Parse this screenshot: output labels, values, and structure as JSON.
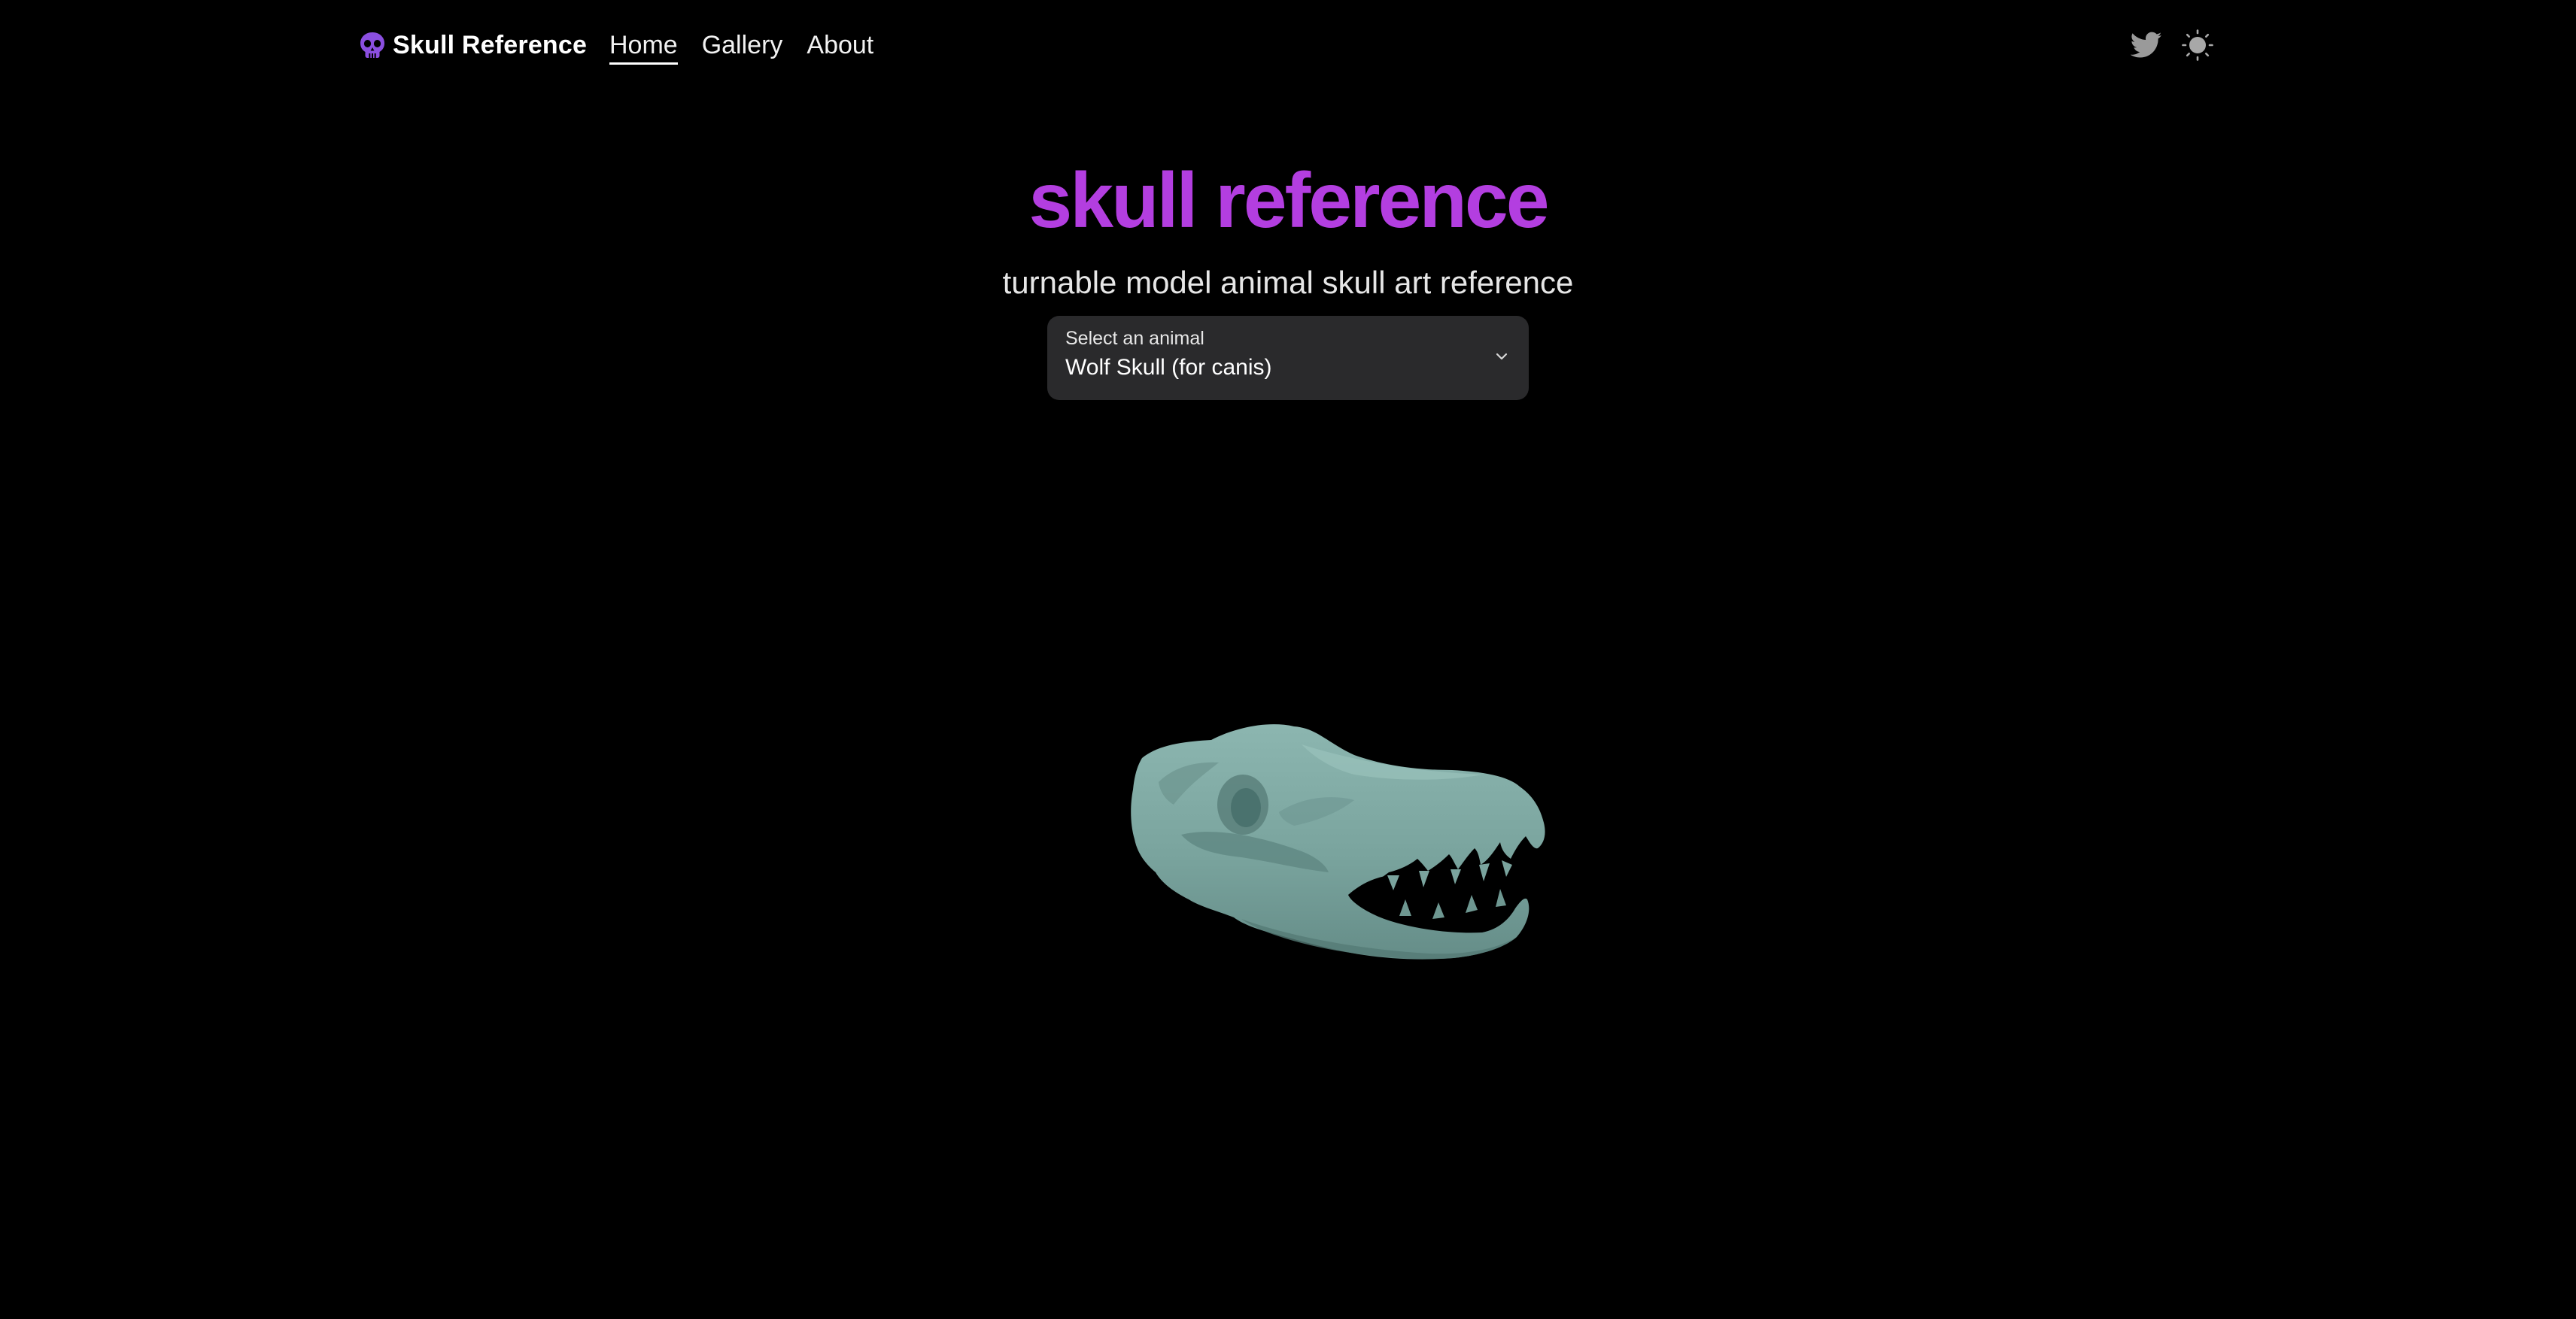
{
  "header": {
    "brand": {
      "name": "Skull Reference",
      "icon": "skull-icon"
    },
    "nav": [
      {
        "label": "Home",
        "active": true
      },
      {
        "label": "Gallery",
        "active": false
      },
      {
        "label": "About",
        "active": false
      }
    ],
    "icons": {
      "twitter": "twitter-icon",
      "theme": "sun-icon"
    }
  },
  "hero": {
    "title": "skull reference",
    "subtitle": "turnable model animal skull art reference"
  },
  "animal_select": {
    "label": "Select an animal",
    "value": "Wolf Skull (for canis)"
  },
  "viewer": {
    "model": "wolf-skull-3d-model"
  },
  "colors": {
    "background": "#000000",
    "accent": "#b33ee0",
    "brand_icon": "#8b4fe0",
    "select_bg": "#2a2a2c",
    "model_tint": "#7ea9a3",
    "icon_grey": "#9a9a9a"
  }
}
